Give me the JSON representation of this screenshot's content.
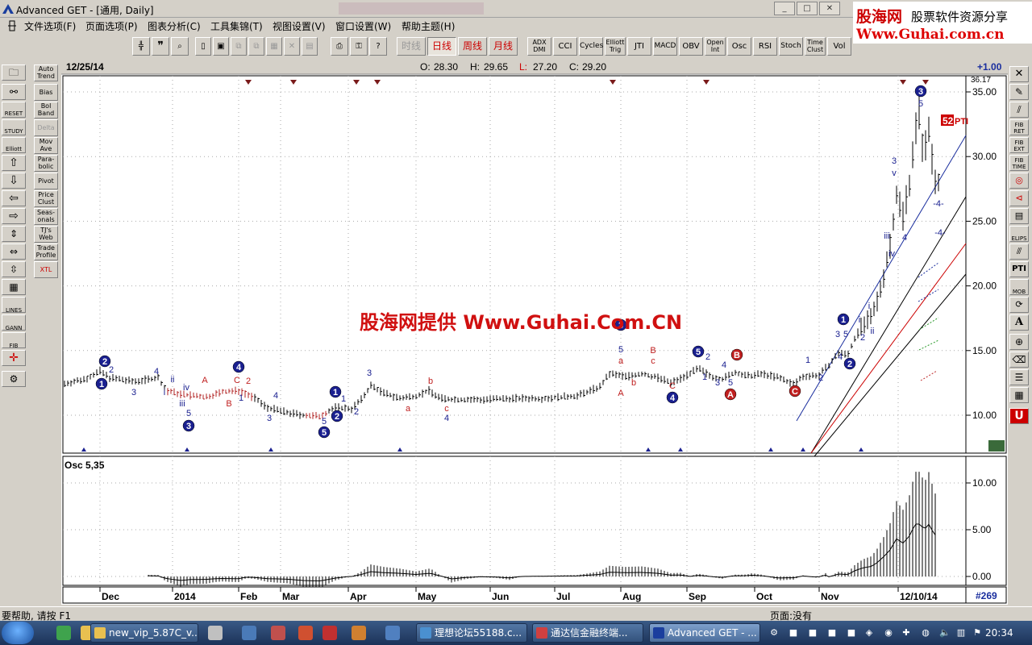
{
  "window": {
    "title": "Advanced GET - [通用, Daily]"
  },
  "watermark": {
    "brand": "股海网",
    "slogan": "股票软件资源分享",
    "url": "Www.Guhai.com.cn"
  },
  "menu": [
    "文件选项(F)",
    "页面选项(P)",
    "图表分析(C)",
    "工具集锦(T)",
    "视图设置(V)",
    "窗口设置(W)",
    "帮助主题(H)"
  ],
  "toolbar": {
    "periods": [
      "时线",
      "日线",
      "周线",
      "月线"
    ],
    "indicators": [
      "ADX DMI",
      "CCI",
      "Cycles",
      "Elliott Trig",
      "JTI",
      "MACD",
      "OBV",
      "Open Int",
      "Osc",
      "RSI",
      "Stoch",
      "Time Clust",
      "Vol"
    ]
  },
  "left_tools_1": [
    "RESET",
    "STUDY",
    "Elliott",
    "LINES",
    "GANN",
    "FIB"
  ],
  "left_tools_2": [
    "Auto Trend",
    "Bias",
    "Bol Band",
    "Delta",
    "Mov Ave",
    "Para-bolic",
    "Pivot",
    "Price Clust",
    "Seas-onals",
    "TJ's Web",
    "Trade Profile",
    "XTL"
  ],
  "right_tools": [
    "FIB RET",
    "FIB EXT",
    "FIB TIME",
    "ELIPS",
    "PTI",
    "MOB",
    "A"
  ],
  "chart": {
    "date": "12/25/14",
    "ohlc": {
      "o_label": "O:",
      "o": "28.30",
      "h_label": "H:",
      "h": "29.65",
      "l_label": "L:",
      "l": "27.20",
      "c_label": "C:",
      "c": "29.20"
    },
    "change": "+1.00",
    "price_ticks": [
      "35.00",
      "30.00",
      "25.00",
      "20.00",
      "15.00",
      "10.00"
    ],
    "top_partial": "36.17",
    "osc_label": "Osc 5,35",
    "osc_ticks": [
      "10.00",
      "5.00",
      "0.00"
    ],
    "months": [
      "Dec",
      "2014",
      "Feb",
      "Mar",
      "Apr",
      "May",
      "Jun",
      "Jul",
      "Aug",
      "Sep",
      "Oct",
      "Nov",
      "12/10/14"
    ],
    "bar_count": "#269",
    "pti_value": "52",
    "pti_label": "PTI",
    "overlay_text": "股海网提供 Www.Guhai.Com.CN",
    "wave_labels": [
      "1",
      "2",
      "3",
      "4",
      "5",
      "i",
      "ii",
      "iii",
      "iv",
      "v",
      "A",
      "B",
      "C",
      "a",
      "b",
      "c",
      "-4-"
    ]
  },
  "status": {
    "help": "要帮助, 请按 F1",
    "page": "页面:没有"
  },
  "taskbar": {
    "tasks": [
      "new_vip_5.87C_v...",
      "理想论坛55188.c...",
      "通达信金融终端...",
      "Advanced GET - ..."
    ],
    "clock": "20:34"
  }
}
